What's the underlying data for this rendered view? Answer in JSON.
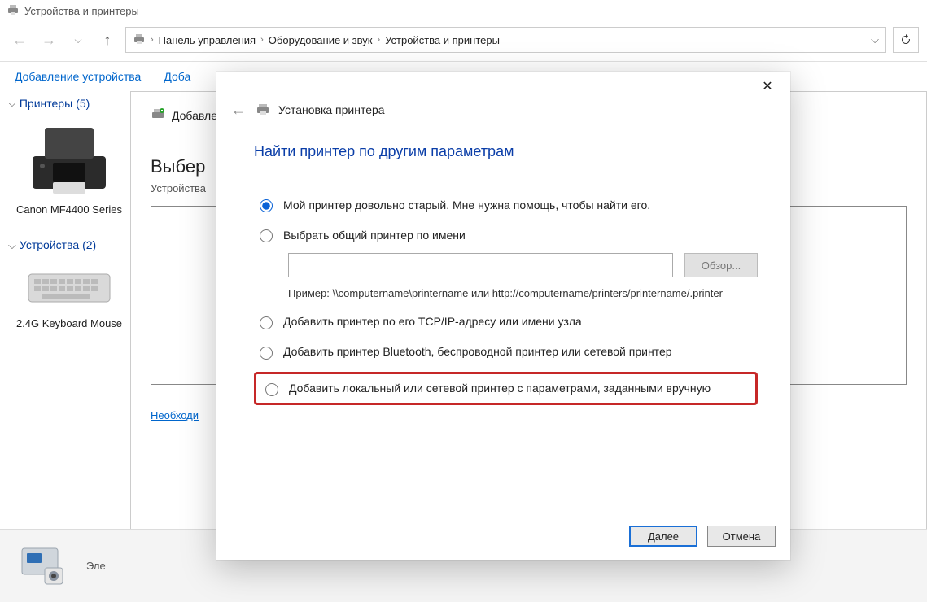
{
  "titlebar": {
    "title": "Устройства и принтеры"
  },
  "breadcrumb": {
    "items": [
      "Панель управления",
      "Оборудование и звук",
      "Устройства и принтеры"
    ]
  },
  "cmdbar": {
    "add_device": "Добавление устройства",
    "add_printer": "Доба"
  },
  "groups": {
    "printers": {
      "label": "Принтеры",
      "count": "(5)"
    },
    "devices": {
      "label": "Устройства",
      "count": "(2)"
    }
  },
  "devices": {
    "printer": "Canon MF4400 Series",
    "keyboard": "2.4G Keyboard Mouse"
  },
  "behind_panel": {
    "header": "Добавление",
    "title": "Выбер",
    "sub": "Устройства",
    "link": "Необходи"
  },
  "status": {
    "label": "Эле"
  },
  "dialog": {
    "header_title": "Установка принтера",
    "blue_title": "Найти принтер по другим параметрам",
    "opt_old": "Мой принтер довольно старый. Мне нужна помощь, чтобы найти его.",
    "opt_shared": "Выбрать общий принтер по имени",
    "browse": "Обзор...",
    "example": "Пример: \\\\computername\\printername или http://computername/printers/printername/.printer",
    "opt_tcp": "Добавить принтер по его TCP/IP-адресу или имени узла",
    "opt_bt": "Добавить принтер Bluetooth, беспроводной принтер или сетевой принтер",
    "opt_manual": "Добавить локальный или сетевой принтер с параметрами, заданными вручную",
    "next": "Далее",
    "cancel": "Отмена"
  }
}
